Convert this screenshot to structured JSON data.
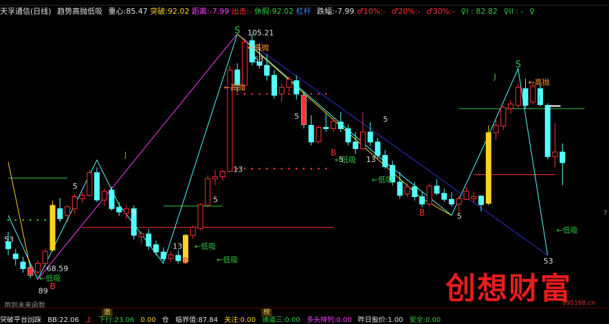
{
  "header": {
    "stock": "天孚通信(日线)",
    "indicator": "趋势高抛低吸",
    "zhongxin_label": "重心:",
    "zhongxin": "85.47",
    "tupo_label": "突破:",
    "tupo": "92.02",
    "juli_label": "距离:",
    "juli": "-7.99",
    "chuji_label": "出击:",
    "chuji": "-",
    "xiujia_label": "休假:",
    "xiujia": "92.02",
    "ganggan": "杠杆",
    "diefu_label": "跌幅:",
    "diefu": "-7.99",
    "p10": "♂10%:-",
    "p20": "♂20%:-",
    "p30": "♂30%:-",
    "r1": "♀I : 82.82",
    "r2": "♀II : -",
    "r3": "♀"
  },
  "annotations": {
    "peak_value": "105.21",
    "low_value": "68.59",
    "gaopao": "高抛",
    "dixi": "低吸",
    "buy": "B",
    "sell": "S",
    "j": "J",
    "n5": "5",
    "n13": "13",
    "n53": "53",
    "n89": "89"
  },
  "note": "用到未来函数",
  "right_mark": "7",
  "watermark": {
    "title": "创想财富",
    "url": "995168.cn"
  },
  "bottom_tabs": [
    "激",
    "榜"
  ],
  "statusbar": {
    "a": "突破平台回踩",
    "b": "BB:22.06",
    "c": "上",
    "d": "下行:23.06",
    "e": "0.00",
    "f": "仓",
    "g": "临界值:87.84",
    "h": "关注:0.00",
    "i": "通道三:0.00",
    "j": "多头排列:0.00",
    "k": "昨日股价:1.00",
    "l": "安全:0.00"
  },
  "colors": {
    "up": "#ff3232",
    "down": "#54ffff",
    "bg": "#000000",
    "gold": "#ffd21e"
  },
  "chart_data": {
    "type": "candlestick",
    "ohlc": [
      [
        74.0,
        75.5,
        72.0,
        73.0
      ],
      [
        72.2,
        73.0,
        70.5,
        71.5
      ],
      [
        71.0,
        71.8,
        69.4,
        70.0
      ],
      [
        70.2,
        70.6,
        68.6,
        69.0
      ],
      [
        69.5,
        71.3,
        69.0,
        70.8
      ],
      [
        70.8,
        73.0,
        70.2,
        72.6
      ],
      [
        72.8,
        80.2,
        72.6,
        79.5
      ],
      [
        79.0,
        80.6,
        77.0,
        77.5
      ],
      [
        78.0,
        79.5,
        77.0,
        79.3
      ],
      [
        79.0,
        81.2,
        78.2,
        80.8
      ],
      [
        80.5,
        81.5,
        79.8,
        81.0
      ],
      [
        81.0,
        84.8,
        80.8,
        84.4
      ],
      [
        84.4,
        85.2,
        80.0,
        80.3
      ],
      [
        80.3,
        82.0,
        79.4,
        81.6
      ],
      [
        81.8,
        82.3,
        78.7,
        79.0
      ],
      [
        79.2,
        80.0,
        77.9,
        78.5
      ],
      [
        78.3,
        79.5,
        77.5,
        79.0
      ],
      [
        79.0,
        79.5,
        74.4,
        75.0
      ],
      [
        74.8,
        75.6,
        73.8,
        75.2
      ],
      [
        75.2,
        76.0,
        72.8,
        73.4
      ],
      [
        73.6,
        74.2,
        72.0,
        72.5
      ],
      [
        72.5,
        73.2,
        71.2,
        71.5
      ],
      [
        71.5,
        72.6,
        71.0,
        72.1
      ],
      [
        72.0,
        72.8,
        70.8,
        71.2
      ],
      [
        71.0,
        75.2,
        70.8,
        75.0
      ],
      [
        75.0,
        76.5,
        74.5,
        76.2
      ],
      [
        76.0,
        79.8,
        75.8,
        79.6
      ],
      [
        79.5,
        84.0,
        79.2,
        83.5
      ],
      [
        83.5,
        84.8,
        82.5,
        83.8
      ],
      [
        83.8,
        84.8,
        83.2,
        84.6
      ],
      [
        84.6,
        100.5,
        84.5,
        99.8
      ],
      [
        99.8,
        100.8,
        96.5,
        97.6
      ],
      [
        97.5,
        104.6,
        97.0,
        104.0
      ],
      [
        104.2,
        105.2,
        100.5,
        101.0
      ],
      [
        101.0,
        103.8,
        100.0,
        100.5
      ],
      [
        100.5,
        102.2,
        98.2,
        99.0
      ],
      [
        99.0,
        99.8,
        95.5,
        96.0
      ],
      [
        96.2,
        97.8,
        95.0,
        97.2
      ],
      [
        97.2,
        98.8,
        96.5,
        98.4
      ],
      [
        98.2,
        99.0,
        95.4,
        96.2
      ],
      [
        96.0,
        96.5,
        91.0,
        91.6
      ],
      [
        91.5,
        93.0,
        88.5,
        89.0
      ],
      [
        89.0,
        91.5,
        88.8,
        91.2
      ],
      [
        91.2,
        93.2,
        90.5,
        91.0
      ],
      [
        91.0,
        92.6,
        90.5,
        92.1
      ],
      [
        92.0,
        93.5,
        90.5,
        91.0
      ],
      [
        91.0,
        91.6,
        88.5,
        89.0
      ],
      [
        89.0,
        90.5,
        87.2,
        88.0
      ],
      [
        88.0,
        93.4,
        87.8,
        90.5
      ],
      [
        90.5,
        92.0,
        88.4,
        89.0
      ],
      [
        89.0,
        89.6,
        86.5,
        87.0
      ],
      [
        87.0,
        87.8,
        85.0,
        85.3
      ],
      [
        85.5,
        86.2,
        82.5,
        83.0
      ],
      [
        83.0,
        84.5,
        80.5,
        81.0
      ],
      [
        81.2,
        82.8,
        80.8,
        82.3
      ],
      [
        82.3,
        83.0,
        80.2,
        80.8
      ],
      [
        80.8,
        81.5,
        79.2,
        79.7
      ],
      [
        79.7,
        82.8,
        79.3,
        82.4
      ],
      [
        82.4,
        83.4,
        81.0,
        81.3
      ],
      [
        81.3,
        82.0,
        80.0,
        80.4
      ],
      [
        80.4,
        81.5,
        79.3,
        79.7
      ],
      [
        79.7,
        80.9,
        78.4,
        80.5
      ],
      [
        80.4,
        82.3,
        80.3,
        81.6
      ],
      [
        80.5,
        81.6,
        80.0,
        80.8
      ],
      [
        80.9,
        81.0,
        78.6,
        79.6
      ],
      [
        79.8,
        91.5,
        79.5,
        90.4
      ],
      [
        90.4,
        92.5,
        89.3,
        91.5
      ],
      [
        91.4,
        94.5,
        90.8,
        94.2
      ],
      [
        94.0,
        95.3,
        93.2,
        94.7
      ],
      [
        94.5,
        97.8,
        94.2,
        97.2
      ],
      [
        97.0,
        98.5,
        94.0,
        94.5
      ],
      [
        95.0,
        98.0,
        94.6,
        97.4
      ],
      [
        97.0,
        97.6,
        94.3,
        94.6
      ],
      [
        94.5,
        94.8,
        86.4,
        86.8
      ],
      [
        86.8,
        91.8,
        85.2,
        87.5
      ],
      [
        87.5,
        88.8,
        82.5,
        85.9
      ]
    ],
    "highlight_gold": [
      6,
      24,
      65
    ],
    "highlight_red": [
      3,
      40
    ],
    "price_range": [
      65,
      107
    ]
  }
}
